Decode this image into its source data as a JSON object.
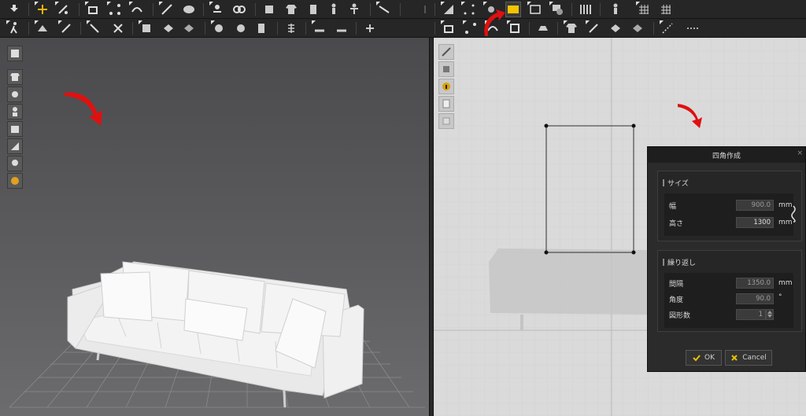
{
  "dialog": {
    "title": "四角作成",
    "close_label": "×",
    "size_section": {
      "title": "サイズ",
      "width_label": "幅",
      "width_value": "900.0",
      "width_unit": "mm",
      "height_label": "高さ",
      "height_value": "1300",
      "height_unit": "mm"
    },
    "repeat_section": {
      "title": "繰り返し",
      "spacing_label": "間隔",
      "spacing_value": "1350.0",
      "spacing_unit": "mm",
      "angle_label": "角度",
      "angle_value": "90.0",
      "angle_unit": "°",
      "count_label": "図形数",
      "count_value": "1"
    },
    "ok_label": "OK",
    "cancel_label": "Cancel"
  },
  "colors": {
    "highlight_tool": "#f5c400",
    "annotation_arrow": "#e01010",
    "ok_check": "#e8c000",
    "cancel_x": "#e8c000"
  },
  "icons": {
    "toolbar_row1": [
      "download-arrow-icon",
      "select-move-icon",
      "select-edit-icon",
      "fold-arrange-icon",
      "transform-points-icon",
      "sewing-icon",
      "line-tool-icon",
      "free-sewing-icon",
      "pin-icon",
      "tack-icon",
      "garment-icon",
      "shirt-icon",
      "avatar-icon",
      "avatar-pose-icon",
      "measure-icon",
      "rectangle-tool-icon",
      "polygon-icon",
      "internal-shape-icon",
      "fabric-icon",
      "figure-icon",
      "grid-icon",
      "grid-alt-icon"
    ],
    "toolbar_row2": [
      "walk-icon",
      "fold-icon",
      "sew-icon",
      "segment-sew-icon",
      "seam-icon",
      "fabric-select-icon",
      "stitch-icon",
      "stitch-alt-icon",
      "button-icon",
      "button-hole-icon",
      "zipper-icon",
      "tape-icon",
      "piping-icon",
      "puckering-icon",
      "iron-icon",
      "hanger-icon",
      "knit-icon",
      "knit-alt-icon",
      "line-icon",
      "dashed-line-icon"
    ],
    "side_3d": [
      "fabric-render-icon",
      "garment-view-icon",
      "pattern-view-icon",
      "avatar-view-icon",
      "texture-view-icon",
      "shading-view-icon",
      "avatar-head-icon",
      "globe-icon"
    ],
    "side_2d": [
      "select-tool-icon",
      "pattern-tool-icon",
      "info-icon",
      "sheet-icon",
      "grid-sheet-icon"
    ]
  }
}
